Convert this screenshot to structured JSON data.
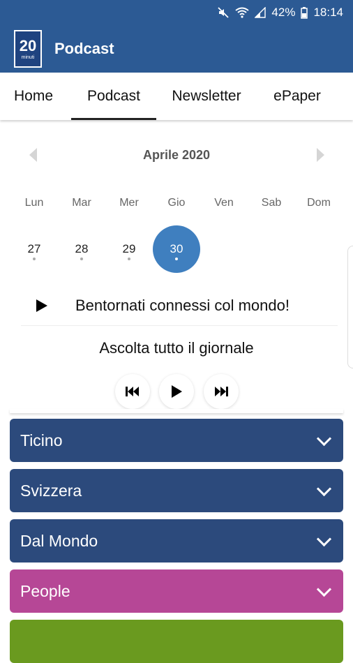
{
  "status_bar": {
    "battery": "42%",
    "time": "18:14"
  },
  "app_bar": {
    "logo_number": "20",
    "logo_text": "minuti",
    "title": "Podcast"
  },
  "tabs": [
    {
      "label": "Home"
    },
    {
      "label": "Podcast"
    },
    {
      "label": "Newsletter"
    },
    {
      "label": "ePaper"
    }
  ],
  "active_tab": "Podcast",
  "calendar": {
    "month": "Aprile 2020",
    "weekdays": [
      "Lun",
      "Mar",
      "Mer",
      "Gio",
      "Ven",
      "Sab",
      "Dom"
    ],
    "days": [
      "27",
      "28",
      "29",
      "30"
    ],
    "selected_day": "30"
  },
  "episode": {
    "title": "Bentornati connessi col mondo!"
  },
  "listen_all": "Ascolta tutto il giornale",
  "categories": [
    {
      "label": "Ticino",
      "color": "#2c4a7c"
    },
    {
      "label": "Svizzera",
      "color": "#2c4a7c"
    },
    {
      "label": "Dal Mondo",
      "color": "#2c4a7c"
    },
    {
      "label": "People",
      "color": "#b64796"
    },
    {
      "label": "",
      "color": "#6a9a1f"
    }
  ]
}
